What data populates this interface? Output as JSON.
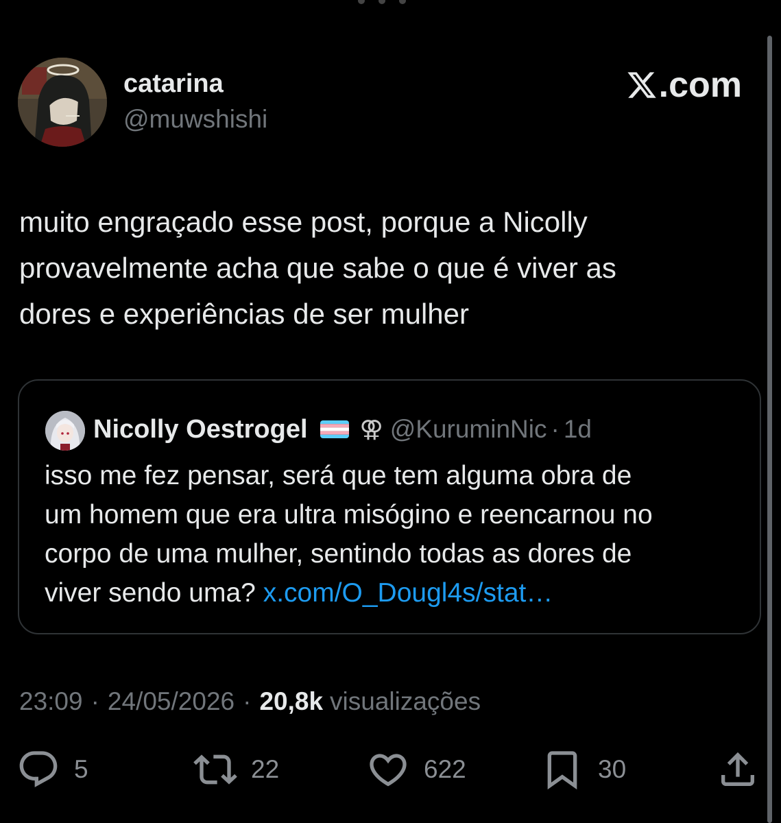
{
  "author": {
    "display_name": "catarina",
    "handle": "@muwshishi"
  },
  "brand": {
    "label": ".com"
  },
  "tweet": {
    "lines": [
      "muito engraçado esse post, porque a Nicolly",
      "provavelmente acha que sabe o que é viver as",
      "dores e experiências de ser mulher"
    ]
  },
  "quote": {
    "display_name": "Nicolly Oestrogel",
    "venus_symbol": "⚢",
    "handle": "@KuruminNic",
    "separator": "·",
    "time": "1d",
    "lines": [
      "isso me fez pensar, será que tem alguma obra de",
      "um homem que era ultra misógino e reencarnou no",
      "corpo de uma mulher, sentindo todas as dores de"
    ],
    "last_line_text": "viver sendo uma?",
    "link": "x.com/O_Dougl4s/stat…"
  },
  "meta": {
    "time": "23:09",
    "date": "24/05/2026",
    "separator": "·",
    "views_count": "20,8k",
    "views_label": "visualizações"
  },
  "actions": {
    "replies": "5",
    "reposts": "22",
    "likes": "622",
    "bookmarks": "30"
  },
  "icons": [
    "reply-icon",
    "repost-icon",
    "like-icon",
    "bookmark-icon",
    "share-icon",
    "x-logo-icon"
  ],
  "colors": {
    "background": "#000000",
    "text": "#e7e9ea",
    "muted": "#71767b",
    "link": "#1d9bf0",
    "border": "#2f3336"
  }
}
